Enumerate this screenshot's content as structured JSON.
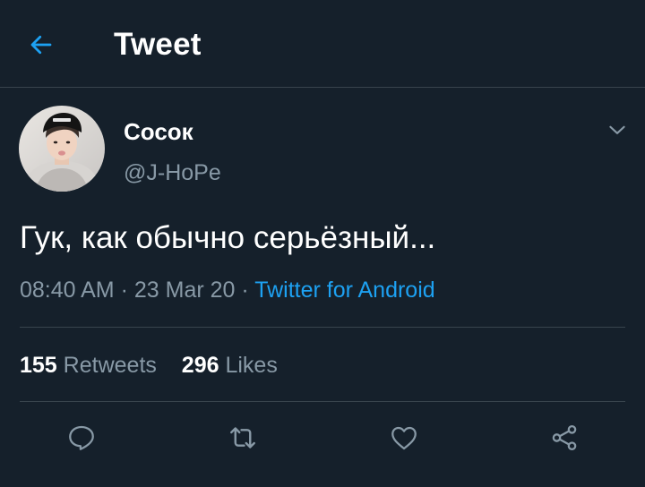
{
  "header": {
    "title": "Tweet",
    "back_icon": "arrow-left-icon"
  },
  "tweet": {
    "display_name": "Сосок",
    "handle": "@J-HoPe",
    "text": "Гук, как обычно серьёзный...",
    "time": "08:40 AM",
    "separator": " · ",
    "date": "23 Mar 20",
    "source": "Twitter for Android",
    "retweets_count": "155",
    "retweets_label": "Retweets",
    "likes_count": "296",
    "likes_label": "Likes"
  },
  "actions": [
    {
      "name": "reply",
      "icon": "reply-icon"
    },
    {
      "name": "retweet",
      "icon": "retweet-icon"
    },
    {
      "name": "like",
      "icon": "heart-icon"
    },
    {
      "name": "share",
      "icon": "share-icon"
    }
  ],
  "colors": {
    "background": "#15202b",
    "accent": "#1da1f2",
    "secondary_text": "#8899a6",
    "divider": "#38444d"
  }
}
